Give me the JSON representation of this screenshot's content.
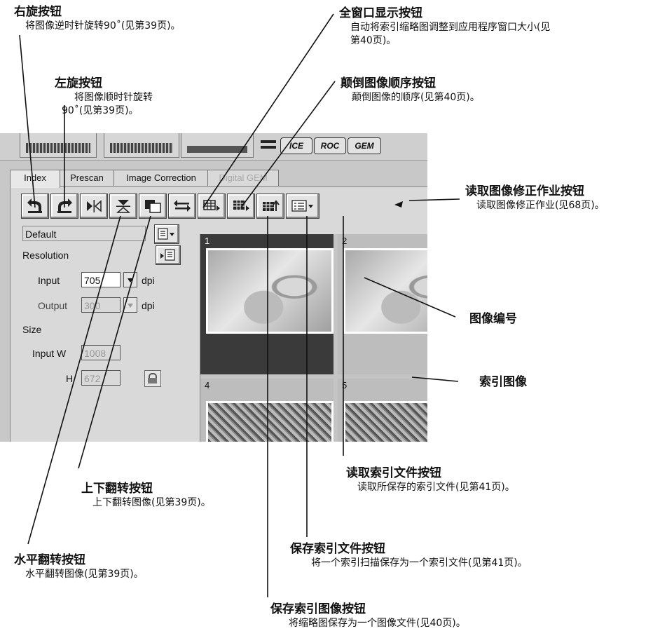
{
  "annotations": {
    "rotate_right": {
      "title": "右旋按钮",
      "desc": "将图像逆时针旋转90˚(见第39页)。"
    },
    "rotate_left": {
      "title": "左旋按钮",
      "desc1": "将图像顺时针旋转",
      "desc2": "90˚(见第39页)。"
    },
    "full_window": {
      "title": "全窗口显示按钮",
      "desc1": "自动将索引缩略图调整到应用程序窗口大小(见",
      "desc2": "第40页)。"
    },
    "reverse_order": {
      "title": "颠倒图像顺序按钮",
      "desc": "颠倒图像的顺序(见第40页)。"
    },
    "load_correction": {
      "title": "读取图像修正作业按钮",
      "desc": "读取图像修正作业(见68页)。"
    },
    "image_number": {
      "title": "图像编号"
    },
    "index_image": {
      "title": "索引图像"
    },
    "load_index_file": {
      "title": "读取索引文件按钮",
      "desc": "读取所保存的索引文件(见第41页)。"
    },
    "flip_vertical": {
      "title": "上下翻转按钮",
      "desc": "上下翻转图像(见第39页)。"
    },
    "save_index_file": {
      "title": "保存索引文件按钮",
      "desc": "将一个索引扫描保存为一个索引文件(见第41页)。"
    },
    "flip_horizontal": {
      "title": "水平翻转按钮",
      "desc": "水平翻转图像(见第39页)。"
    },
    "save_index_image": {
      "title": "保存索引图像按钮",
      "desc": "将缩略图保存为一个图像文件(见40页)。"
    }
  },
  "ui": {
    "top_chips": [
      "ICE",
      "ROC",
      "GEM"
    ],
    "tabs": [
      "Index",
      "Prescan",
      "Image Correction",
      "Digital GEM"
    ],
    "toolbar_icons": [
      "rotate-left-icon",
      "rotate-right-icon",
      "flip-horizontal-icon",
      "flip-vertical-icon",
      "full-window-icon",
      "reverse-order-icon",
      "save-index-image-icon",
      "save-index-file-icon",
      "load-index-file-icon",
      "load-correction-icon"
    ],
    "settings": {
      "preset": "Default",
      "resolution_label": "Resolution",
      "input_label": "Input",
      "input_value": "705",
      "input_unit": "dpi",
      "output_label": "Output",
      "output_value": "300",
      "output_unit": "dpi",
      "size_label": "Size",
      "width_label": "Input W",
      "width_value": "1008",
      "height_label": "H",
      "height_value": "672"
    },
    "frames": [
      "1",
      "2",
      "4",
      "5"
    ]
  }
}
